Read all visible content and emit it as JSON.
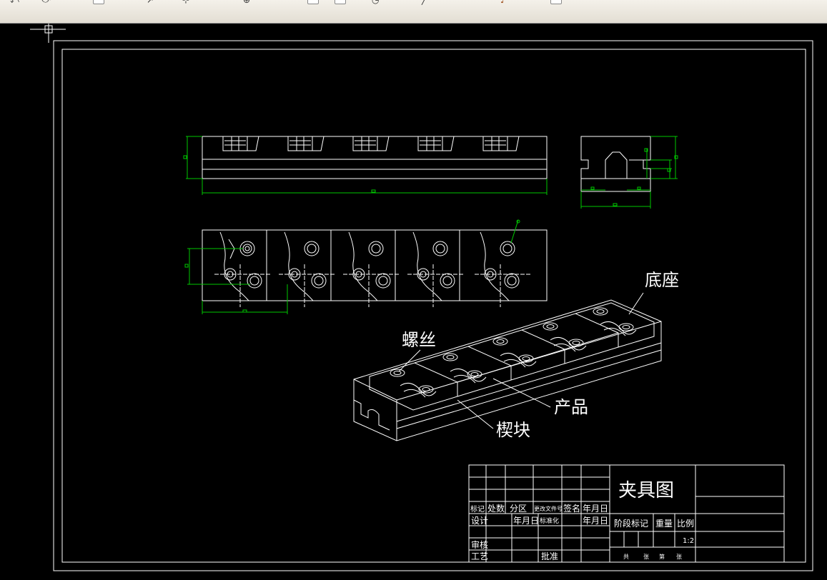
{
  "toolbar": {
    "icons": [
      "undo-icon",
      "redo-icon",
      "properties-icon",
      "match-properties-icon",
      "pan-icon",
      "zoom-icon",
      "layer-icon",
      "color-icon",
      "linetype-icon",
      "lineweight-icon"
    ]
  },
  "colors": {
    "background": "#000000",
    "lines": "#ffffff",
    "dimensions": "#00c800",
    "toolbar": "#ece9d8"
  },
  "callouts": {
    "base": "底座",
    "screw": "螺丝",
    "product": "产品",
    "wedge": "楔块"
  },
  "title_block": {
    "drawing_title": "夹具图",
    "marker": "标记",
    "count": "处数",
    "zone": "分区",
    "change_doc": "更改文件号",
    "signature": "签名",
    "date": "年月日",
    "design": "设计",
    "standardization": "标准化",
    "stage_mark": "阶段标记",
    "weight": "重量",
    "scale_label": "比例",
    "scale_value": "1:2",
    "review": "审核",
    "process": "工艺",
    "approve": "批准",
    "sheets_total": "共",
    "sheets_unit": "张",
    "sheet_no": "第",
    "sheet_unit2": "张"
  }
}
